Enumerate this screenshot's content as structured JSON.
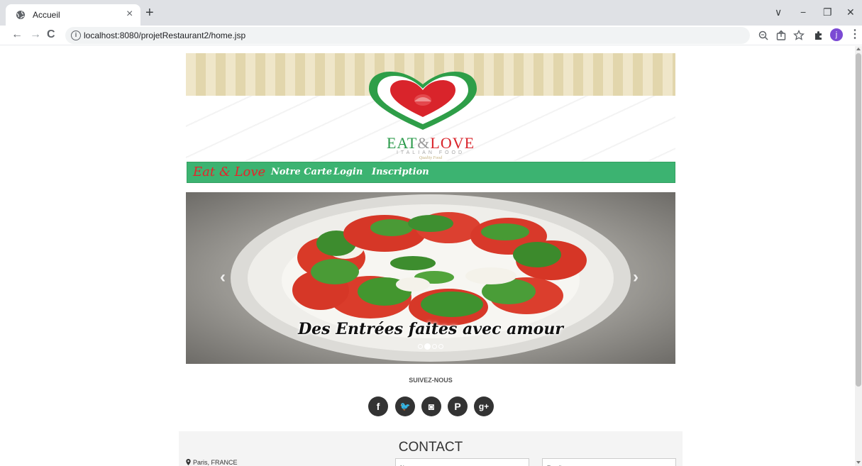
{
  "browser": {
    "tab_title": "Accueil",
    "tab_close": "×",
    "new_tab": "+",
    "url": "localhost:8080/projetRestaurant2/home.jsp",
    "window_controls": [
      "∨",
      "−",
      "❐",
      "✕"
    ],
    "avatar_letter": "j"
  },
  "header": {
    "brand_eat": "EAT",
    "brand_amp": "&",
    "brand_love": "LOVE",
    "brand_sub": "ITALIAN FOOD",
    "brand_tagline": "Quality Food"
  },
  "navbar": {
    "brand": "Eat & Love",
    "links": [
      "Notre Carte",
      "Login",
      "Inscription"
    ],
    "color": "#3cb371"
  },
  "carousel": {
    "caption": "Des Entrées faites avec amour",
    "prev": "‹",
    "next": "›",
    "slide_count": 4,
    "active_index": 1
  },
  "social": {
    "title": "SUIVEZ-NOUS",
    "icons": [
      "facebook-icon",
      "twitter-icon",
      "instagram-icon",
      "pinterest-icon",
      "google-plus-icon"
    ],
    "glyphs": [
      "f",
      "🐦",
      "◙",
      "P",
      "g+"
    ]
  },
  "contact": {
    "title": "CONTACT",
    "location": "Paris, FRANCE",
    "name_placeholder": "Nom",
    "email_placeholder": "Email"
  }
}
